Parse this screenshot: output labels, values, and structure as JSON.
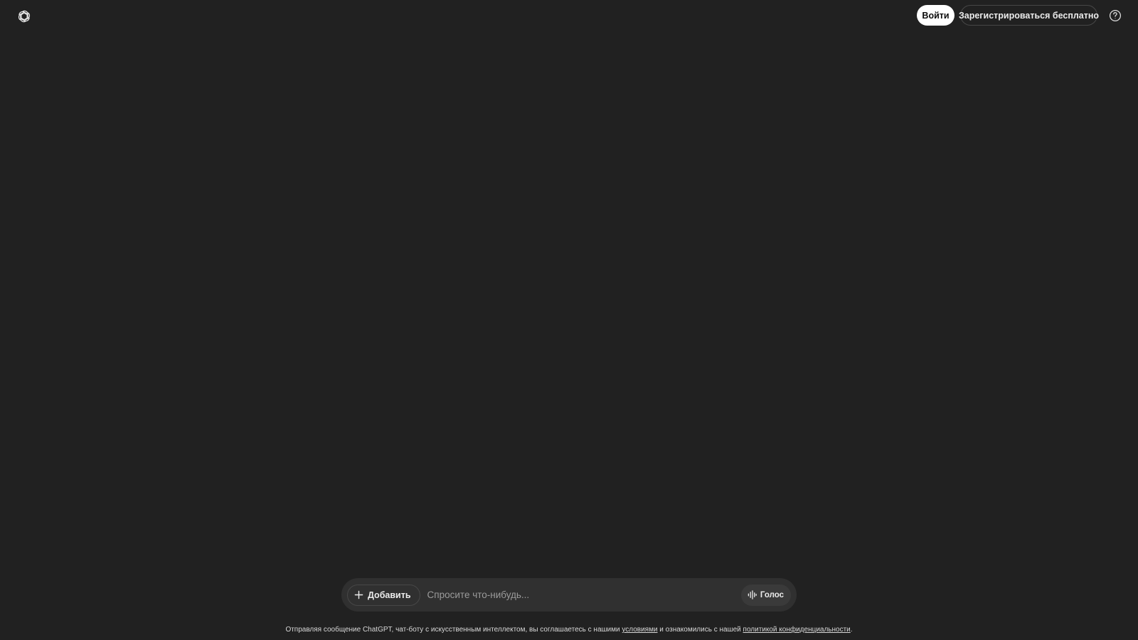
{
  "header": {
    "logo_icon": "openai-logo-icon",
    "login_label": "Войти",
    "signup_label": "Зарегистрироваться бесплатно",
    "help_icon": "help-circle-icon"
  },
  "composer": {
    "add_label": "Добавить",
    "add_icon": "plus-icon",
    "placeholder": "Спросите что-нибудь...",
    "voice_label": "Голос",
    "voice_icon": "voice-wave-icon"
  },
  "footer": {
    "prefix": "Отправляя сообщение ChatGPT, чат-боту с искусственным интеллектом, вы соглашаетесь с нашими ",
    "terms_link": "условиями",
    "middle": " и ознакомились с нашей ",
    "privacy_link": "политикой конфиденциальности",
    "suffix": "."
  },
  "colors": {
    "background": "#212121",
    "composer": "#303030",
    "login_button": "#ffffff",
    "text": "#ececec"
  }
}
